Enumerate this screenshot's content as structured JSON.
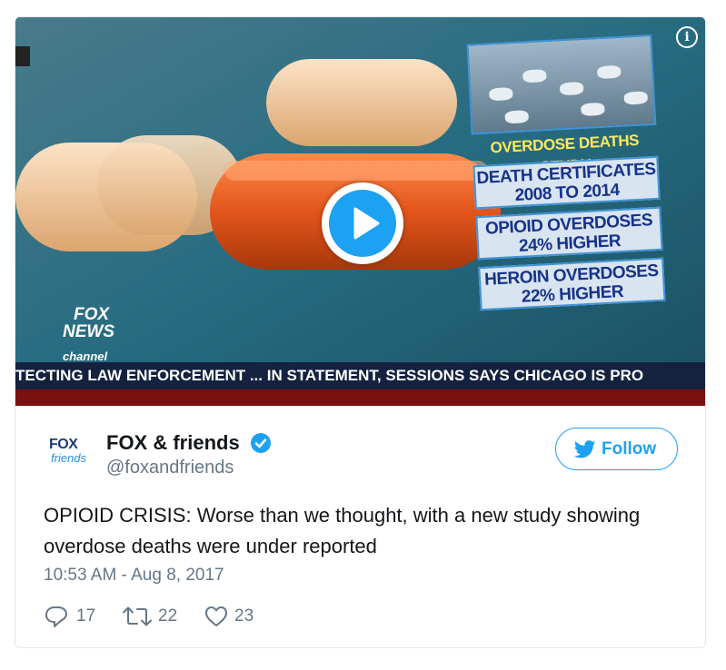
{
  "video": {
    "infographic": {
      "title": "OVERDOSE DEATHS STUDY",
      "box1_line1": "DEATH CERTIFICATES",
      "box1_line2": "2008 TO 2014",
      "box2_line1": "OPIOID OVERDOSES",
      "box2_line2": "24% HIGHER",
      "box3_line1": "HEROIN OVERDOSES",
      "box3_line2": "22% HIGHER"
    },
    "logo_line1": "FOX",
    "logo_line2": "NEWS",
    "channel": "channel",
    "ticker": "TECTING LAW ENFORCEMENT ... IN STATEMENT, SESSIONS SAYS CHICAGO IS PRO",
    "info_icon": "info-icon",
    "play_icon": "play-icon"
  },
  "tweet": {
    "avatar_line1": "FOX",
    "avatar_line2": "friends",
    "display_name": "FOX & friends",
    "handle": "@foxandfriends",
    "follow_label": "Follow",
    "text": "OPIOID CRISIS: Worse than we thought, with a new study showing overdose deaths were under reported",
    "timestamp": "10:53 AM - Aug 8, 2017",
    "reply_count": "17",
    "retweet_count": "22",
    "like_count": "23"
  },
  "colors": {
    "twitter_blue": "#1da1f2",
    "muted_gray": "#657786",
    "ticker_bg": "#14223f"
  }
}
